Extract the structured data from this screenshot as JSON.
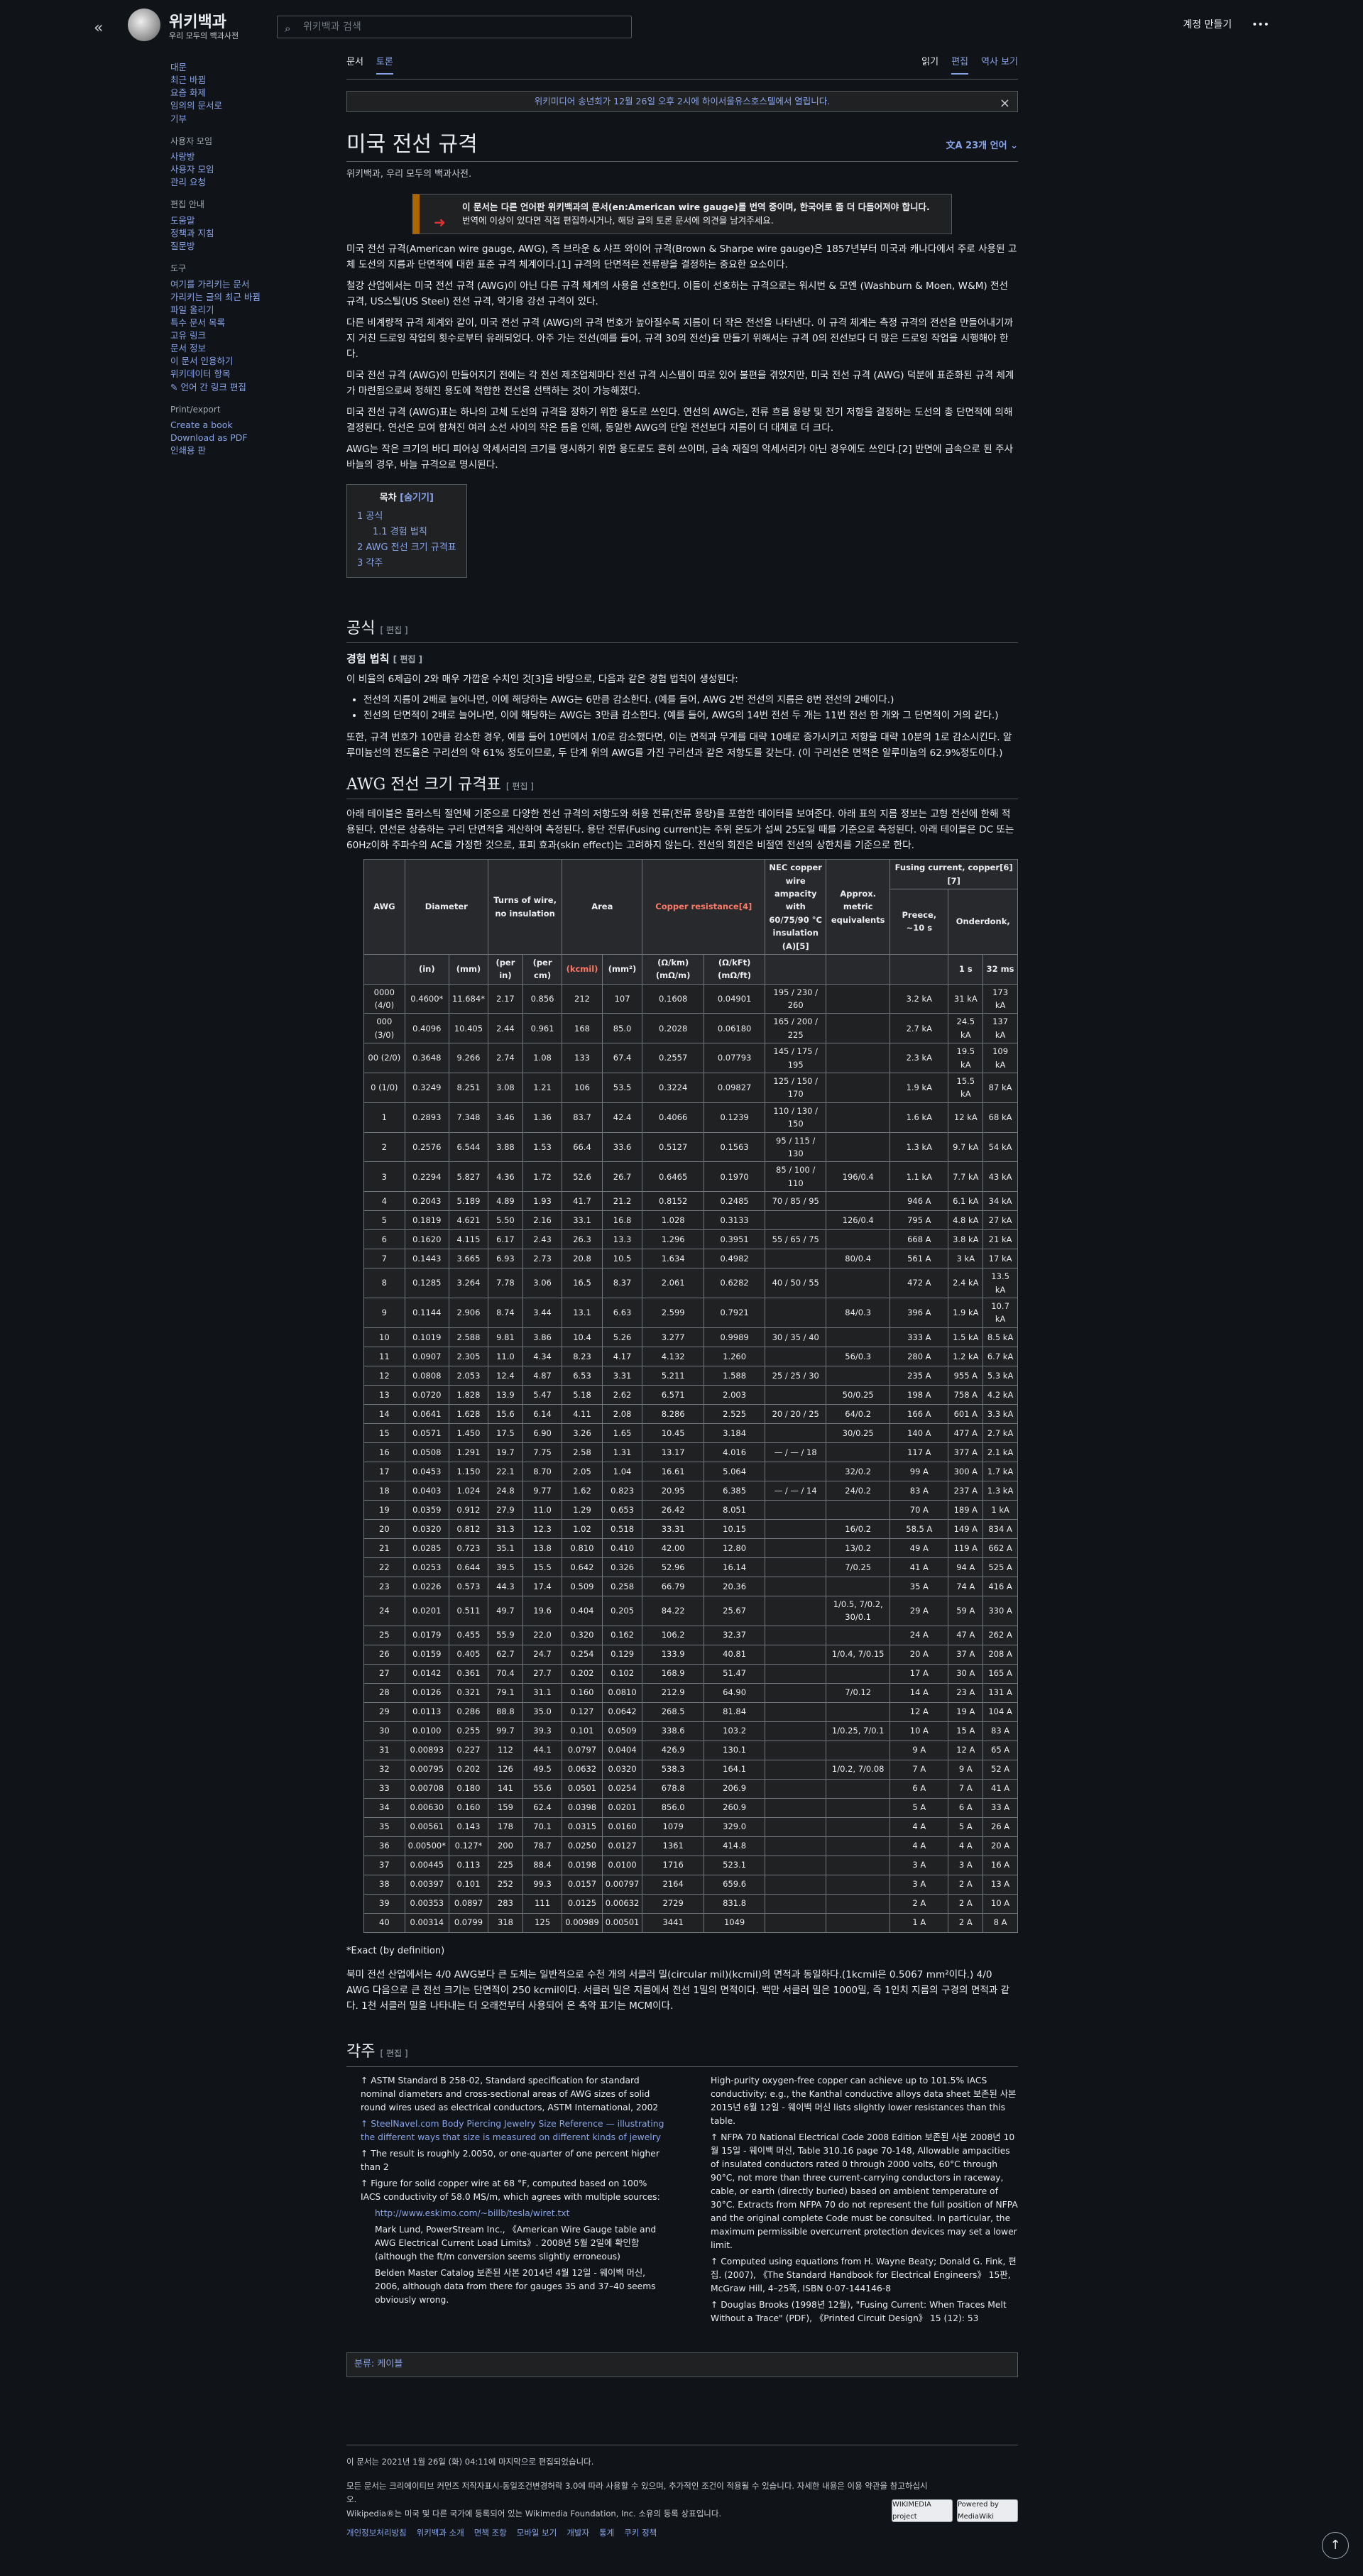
{
  "site": {
    "title": "위키백과",
    "subtitle": "우리 모두의 백과사전",
    "search_placeholder": "위키백과 검색",
    "create_account": "계정 만들기",
    "more": "•••"
  },
  "sidebar": {
    "main": [
      "대문",
      "최근 바뀜",
      "요즘 화제",
      "임의의 문서로",
      "기부"
    ],
    "users_title": "사용자 모임",
    "users": [
      "사랑방",
      "사용자 모임",
      "관리 요청"
    ],
    "guide_title": "편집 안내",
    "guide": [
      "도움말",
      "정책과 지침",
      "질문방"
    ],
    "tools_title": "도구",
    "tools": [
      "여기를 가리키는 문서",
      "가리키는 글의 최근 바뀜",
      "파일 올리기",
      "특수 문서 목록",
      "고유 링크",
      "문서 정보",
      "이 문서 인용하기",
      "위키데이터 항목",
      "언어 간 링크 편집"
    ],
    "print_title": "Print/export",
    "print": [
      "Create a book",
      "Download as PDF",
      "인쇄용 판"
    ]
  },
  "tabs": {
    "article": "문서",
    "talk": "토론",
    "read": "읽기",
    "edit": "편집",
    "history": "역사 보기"
  },
  "notice": "위키미디어 송년회가 12월 26일 오후 2시에 하이서울유스호스텔에서 열립니다.",
  "article": {
    "title": "미국 전선 규격",
    "lang_button": "23개 언어",
    "from": "위키백과, 우리 모두의 백과사전.",
    "ambox_1": "이 문서는 다른 언어판 위키백과의 문서(en:American wire gauge)를 번역 중이며, 한국어로 좀 더 다듬어져야 합니다.",
    "ambox_2": "번역에 이상이 있다면 직접 편집하시거나, 해당 글의 토론 문서에 의견을 남겨주세요.",
    "p1": "미국 전선 규격(American wire gauge, AWG), 즉 브라운 & 샤프 와이어 규격(Brown & Sharpe wire gauge)은 1857년부터 미국과 캐나다에서 주로 사용된 고체 도선의 지름과 단면적에 대한 표준 규격 체계이다.[1] 규격의 단면적은 전류량을 결정하는 중요한 요소이다.",
    "p2": "철강 산업에서는 미국 전선 규격 (AWG)이 아닌 다른 규격 체계의 사용을 선호한다. 이들이 선호하는 규격으로는 워시번 & 모엔 (Washburn & Moen, W&M) 전선 규격, US스틸(US Steel) 전선 규격, 악기용 강선 규격이 있다.",
    "p3": "다른 비계량적 규격 체계와 같이, 미국 전선 규격 (AWG)의 규격 번호가 높아질수록 지름이 더 작은 전선을 나타낸다. 이 규격 체계는 측정 규격의 전선을 만들어내기까지 거친 드로잉 작업의 횟수로부터 유래되었다. 아주 가는 전선(예를 들어, 규격 30의 전선)을 만들기 위해서는 규격 0의 전선보다 더 많은 드로잉 작업을 시행해야 한다.",
    "p4": "미국 전선 규격 (AWG)이 만들어지기 전에는 각 전선 제조업체마다 전선 규격 시스템이 따로 있어 불편을 겪었지만, 미국 전선 규격 (AWG) 덕분에 표준화된 규격 체계가 마련됨으로써 정해진 용도에 적합한 전선을 선택하는 것이 가능해졌다.",
    "p5": "미국 전선 규격 (AWG)표는 하나의 고체 도선의 규격을 정하기 위한 용도로 쓰인다. 연선의 AWG는, 전류 흐름 용량 및 전기 저항을 결정하는 도선의 총 단면적에 의해 결정된다. 연선은 모여 합쳐진 여러 소선 사이의 작은 틈을 인해, 동일한 AWG의 단일 전선보다 지름이 더 대체로 더 크다.",
    "p6": "AWG는 작은 크기의 바디 피어싱 악세서리의 크기를 명시하기 위한 용도로도 흔히 쓰이며, 금속 재질의 악세서리가 아닌 경우에도 쓰인다.[2] 반면에 금속으로 된 주사 바늘의 경우, 바늘 규격으로 명시된다."
  },
  "toc": {
    "title": "목차",
    "toggle": "[숨기기]",
    "items": [
      "1 공식",
      "1.1 경험 법칙",
      "2 AWG 전선 크기 규격표",
      "3 각주"
    ]
  },
  "sections": {
    "formula": "공식",
    "edit": "[ 편집 ]",
    "rule": "경험 법칙",
    "rule_intro": "이 비율의 6제곱이 2와 매우 가깝운 수치인 것[3]을 바탕으로, 다음과 같은 경험 법칙이 생성된다:",
    "rule_1": "전선의 지름이 2배로 늘어나면, 이에 해당하는 AWG는 6만큼 감소한다. (예를 들어, AWG 2번 전선의 지름은 8번 전선의 2배이다.)",
    "rule_2": "전선의 단면적이 2배로 늘어나면, 이에 해당하는 AWG는 3만큼 감소한다. (예를 들어, AWG의 14번 전선 두 개는 11번 전선 한 개와 그 단면적이 거의 같다.)",
    "rule_after": "또한, 규격 번호가 10만큼 감소한 경우, 예를 들어 10번에서 1/0로 감소했다면, 이는 면적과 무게를 대략 10배로 증가시키고 저항을 대략 10분의 1로 감소시킨다. 알루미늄선의 전도율은 구리선의 약 61% 정도이므로, 두 단계 위의 AWG를 가진 구리선과 같은 저항도를 갖는다. (이 구리선은 면적은 알루미늄의 62.9%정도이다.)",
    "table_title": "AWG 전선 크기 규격표",
    "table_intro": "아래 테이블은 플라스틱 절연체 기준으로 다양한 전선 규격의 저항도와 허용 전류(전류 용량)를 포함한 데이터를 보여준다. 아래 표의 지름 정보는 고형 전선에 한해 적용된다. 연선은 상층하는 구리 단면적을 계산하여 측정된다. 용단 전류(Fusing current)는 주위 온도가 섭씨 25도일 때를 기준으로 측정된다. 아래 테이블은 DC 또는 60Hz이하 주파수의 AC를 가정한 것으로, 표피 효과(skin effect)는 고려하지 않는다. 전선의 회전은 비절연 전선의 상한치를 기준으로 한다.",
    "exact": "*Exact (by definition)",
    "after_table": "북미 전선 산업에서는 4/0 AWG보다 큰 도체는 일반적으로 수천 개의 서클러 밀(circular mil)(kcmil)의 면적과 동일하다.(1kcmil은 0.5067 mm²이다.) 4/0 AWG 다음으로 큰 전선 크기는 단면적이 250 kcmil이다. 서클러 밀은 지름에서 전선 1밀의 면적이다. 백만 서클러 밀은 1000밀, 즉 1인치 지름의 구경의 면적과 같다. 1천 서클러 밀을 나타내는 더 오래전부터 사용되어 온 축약 표기는 MCM이다.",
    "notes": "각주"
  },
  "table": {
    "h_awg": "AWG",
    "h_diam": "Diameter",
    "h_turns": "Turns of wire, no insulation",
    "h_area": "Area",
    "h_res": "Copper resistance[4]",
    "h_nec": "NEC copper wire ampacity with 60/75/90 °C insulation (A)[5]",
    "h_metric": "Approx. metric equivalents",
    "h_fuse": "Fusing current, copper[6][7]",
    "h_in": "(in)",
    "h_mm": "(mm)",
    "h_perin": "(per in)",
    "h_percm": "(per cm)",
    "h_kcmil": "(kcmil)",
    "h_mm2": "(mm²)",
    "h_okm": "(Ω/km) (mΩ/m)",
    "h_okft": "(Ω/kFt) (mΩ/ft)",
    "h_preece": "Preece, ~10 s",
    "h_onder": "Onderdonk,",
    "h_1s": "1 s",
    "h_32ms": "32 ms",
    "rows": [
      [
        "0000 (4/0)",
        "0.4600*",
        "11.684*",
        "2.17",
        "0.856",
        "212",
        "107",
        "0.1608",
        "0.04901",
        "195 / 230 / 260",
        "",
        "3.2 kA",
        "31 kA",
        "173 kA"
      ],
      [
        "000 (3/0)",
        "0.4096",
        "10.405",
        "2.44",
        "0.961",
        "168",
        "85.0",
        "0.2028",
        "0.06180",
        "165 / 200 / 225",
        "",
        "2.7 kA",
        "24.5 kA",
        "137 kA"
      ],
      [
        "00 (2/0)",
        "0.3648",
        "9.266",
        "2.74",
        "1.08",
        "133",
        "67.4",
        "0.2557",
        "0.07793",
        "145 / 175 / 195",
        "",
        "2.3 kA",
        "19.5 kA",
        "109 kA"
      ],
      [
        "0 (1/0)",
        "0.3249",
        "8.251",
        "3.08",
        "1.21",
        "106",
        "53.5",
        "0.3224",
        "0.09827",
        "125 / 150 / 170",
        "",
        "1.9 kA",
        "15.5 kA",
        "87 kA"
      ],
      [
        "1",
        "0.2893",
        "7.348",
        "3.46",
        "1.36",
        "83.7",
        "42.4",
        "0.4066",
        "0.1239",
        "110 / 130 / 150",
        "",
        "1.6 kA",
        "12 kA",
        "68 kA"
      ],
      [
        "2",
        "0.2576",
        "6.544",
        "3.88",
        "1.53",
        "66.4",
        "33.6",
        "0.5127",
        "0.1563",
        "95 / 115 / 130",
        "",
        "1.3 kA",
        "9.7 kA",
        "54 kA"
      ],
      [
        "3",
        "0.2294",
        "5.827",
        "4.36",
        "1.72",
        "52.6",
        "26.7",
        "0.6465",
        "0.1970",
        "85 / 100 / 110",
        "196/0.4",
        "1.1 kA",
        "7.7 kA",
        "43 kA"
      ],
      [
        "4",
        "0.2043",
        "5.189",
        "4.89",
        "1.93",
        "41.7",
        "21.2",
        "0.8152",
        "0.2485",
        "70 / 85 / 95",
        "",
        "946 A",
        "6.1 kA",
        "34 kA"
      ],
      [
        "5",
        "0.1819",
        "4.621",
        "5.50",
        "2.16",
        "33.1",
        "16.8",
        "1.028",
        "0.3133",
        "",
        "126/0.4",
        "795 A",
        "4.8 kA",
        "27 kA"
      ],
      [
        "6",
        "0.1620",
        "4.115",
        "6.17",
        "2.43",
        "26.3",
        "13.3",
        "1.296",
        "0.3951",
        "55 / 65 / 75",
        "",
        "668 A",
        "3.8 kA",
        "21 kA"
      ],
      [
        "7",
        "0.1443",
        "3.665",
        "6.93",
        "2.73",
        "20.8",
        "10.5",
        "1.634",
        "0.4982",
        "",
        "80/0.4",
        "561 A",
        "3 kA",
        "17 kA"
      ],
      [
        "8",
        "0.1285",
        "3.264",
        "7.78",
        "3.06",
        "16.5",
        "8.37",
        "2.061",
        "0.6282",
        "40 / 50 / 55",
        "",
        "472 A",
        "2.4 kA",
        "13.5 kA"
      ],
      [
        "9",
        "0.1144",
        "2.906",
        "8.74",
        "3.44",
        "13.1",
        "6.63",
        "2.599",
        "0.7921",
        "",
        "84/0.3",
        "396 A",
        "1.9 kA",
        "10.7 kA"
      ],
      [
        "10",
        "0.1019",
        "2.588",
        "9.81",
        "3.86",
        "10.4",
        "5.26",
        "3.277",
        "0.9989",
        "30 / 35 / 40",
        "",
        "333 A",
        "1.5 kA",
        "8.5 kA"
      ],
      [
        "11",
        "0.0907",
        "2.305",
        "11.0",
        "4.34",
        "8.23",
        "4.17",
        "4.132",
        "1.260",
        "",
        "56/0.3",
        "280 A",
        "1.2 kA",
        "6.7 kA"
      ],
      [
        "12",
        "0.0808",
        "2.053",
        "12.4",
        "4.87",
        "6.53",
        "3.31",
        "5.211",
        "1.588",
        "25 / 25 / 30",
        "",
        "235 A",
        "955 A",
        "5.3 kA"
      ],
      [
        "13",
        "0.0720",
        "1.828",
        "13.9",
        "5.47",
        "5.18",
        "2.62",
        "6.571",
        "2.003",
        "",
        "50/0.25",
        "198 A",
        "758 A",
        "4.2 kA"
      ],
      [
        "14",
        "0.0641",
        "1.628",
        "15.6",
        "6.14",
        "4.11",
        "2.08",
        "8.286",
        "2.525",
        "20 / 20 / 25",
        "64/0.2",
        "166 A",
        "601 A",
        "3.3 kA"
      ],
      [
        "15",
        "0.0571",
        "1.450",
        "17.5",
        "6.90",
        "3.26",
        "1.65",
        "10.45",
        "3.184",
        "",
        "30/0.25",
        "140 A",
        "477 A",
        "2.7 kA"
      ],
      [
        "16",
        "0.0508",
        "1.291",
        "19.7",
        "7.75",
        "2.58",
        "1.31",
        "13.17",
        "4.016",
        "— / — / 18",
        "",
        "117 A",
        "377 A",
        "2.1 kA"
      ],
      [
        "17",
        "0.0453",
        "1.150",
        "22.1",
        "8.70",
        "2.05",
        "1.04",
        "16.61",
        "5.064",
        "",
        "32/0.2",
        "99 A",
        "300 A",
        "1.7 kA"
      ],
      [
        "18",
        "0.0403",
        "1.024",
        "24.8",
        "9.77",
        "1.62",
        "0.823",
        "20.95",
        "6.385",
        "— / — / 14",
        "24/0.2",
        "83 A",
        "237 A",
        "1.3 kA"
      ],
      [
        "19",
        "0.0359",
        "0.912",
        "27.9",
        "11.0",
        "1.29",
        "0.653",
        "26.42",
        "8.051",
        "",
        "",
        "70 A",
        "189 A",
        "1 kA"
      ],
      [
        "20",
        "0.0320",
        "0.812",
        "31.3",
        "12.3",
        "1.02",
        "0.518",
        "33.31",
        "10.15",
        "",
        "16/0.2",
        "58.5 A",
        "149 A",
        "834 A"
      ],
      [
        "21",
        "0.0285",
        "0.723",
        "35.1",
        "13.8",
        "0.810",
        "0.410",
        "42.00",
        "12.80",
        "",
        "13/0.2",
        "49 A",
        "119 A",
        "662 A"
      ],
      [
        "22",
        "0.0253",
        "0.644",
        "39.5",
        "15.5",
        "0.642",
        "0.326",
        "52.96",
        "16.14",
        "",
        "7/0.25",
        "41 A",
        "94 A",
        "525 A"
      ],
      [
        "23",
        "0.0226",
        "0.573",
        "44.3",
        "17.4",
        "0.509",
        "0.258",
        "66.79",
        "20.36",
        "",
        "",
        "35 A",
        "74 A",
        "416 A"
      ],
      [
        "24",
        "0.0201",
        "0.511",
        "49.7",
        "19.6",
        "0.404",
        "0.205",
        "84.22",
        "25.67",
        "",
        "1/0.5, 7/0.2, 30/0.1",
        "29 A",
        "59 A",
        "330 A"
      ],
      [
        "25",
        "0.0179",
        "0.455",
        "55.9",
        "22.0",
        "0.320",
        "0.162",
        "106.2",
        "32.37",
        "",
        "",
        "24 A",
        "47 A",
        "262 A"
      ],
      [
        "26",
        "0.0159",
        "0.405",
        "62.7",
        "24.7",
        "0.254",
        "0.129",
        "133.9",
        "40.81",
        "",
        "1/0.4, 7/0.15",
        "20 A",
        "37 A",
        "208 A"
      ],
      [
        "27",
        "0.0142",
        "0.361",
        "70.4",
        "27.7",
        "0.202",
        "0.102",
        "168.9",
        "51.47",
        "",
        "",
        "17 A",
        "30 A",
        "165 A"
      ],
      [
        "28",
        "0.0126",
        "0.321",
        "79.1",
        "31.1",
        "0.160",
        "0.0810",
        "212.9",
        "64.90",
        "",
        "7/0.12",
        "14 A",
        "23 A",
        "131 A"
      ],
      [
        "29",
        "0.0113",
        "0.286",
        "88.8",
        "35.0",
        "0.127",
        "0.0642",
        "268.5",
        "81.84",
        "",
        "",
        "12 A",
        "19 A",
        "104 A"
      ],
      [
        "30",
        "0.0100",
        "0.255",
        "99.7",
        "39.3",
        "0.101",
        "0.0509",
        "338.6",
        "103.2",
        "",
        "1/0.25, 7/0.1",
        "10 A",
        "15 A",
        "83 A"
      ],
      [
        "31",
        "0.00893",
        "0.227",
        "112",
        "44.1",
        "0.0797",
        "0.0404",
        "426.9",
        "130.1",
        "",
        "",
        "9 A",
        "12 A",
        "65 A"
      ],
      [
        "32",
        "0.00795",
        "0.202",
        "126",
        "49.5",
        "0.0632",
        "0.0320",
        "538.3",
        "164.1",
        "",
        "1/0.2, 7/0.08",
        "7 A",
        "9 A",
        "52 A"
      ],
      [
        "33",
        "0.00708",
        "0.180",
        "141",
        "55.6",
        "0.0501",
        "0.0254",
        "678.8",
        "206.9",
        "",
        "",
        "6 A",
        "7 A",
        "41 A"
      ],
      [
        "34",
        "0.00630",
        "0.160",
        "159",
        "62.4",
        "0.0398",
        "0.0201",
        "856.0",
        "260.9",
        "",
        "",
        "5 A",
        "6 A",
        "33 A"
      ],
      [
        "35",
        "0.00561",
        "0.143",
        "178",
        "70.1",
        "0.0315",
        "0.0160",
        "1079",
        "329.0",
        "",
        "",
        "4 A",
        "5 A",
        "26 A"
      ],
      [
        "36",
        "0.00500*",
        "0.127*",
        "200",
        "78.7",
        "0.0250",
        "0.0127",
        "1361",
        "414.8",
        "",
        "",
        "4 A",
        "4 A",
        "20 A"
      ],
      [
        "37",
        "0.00445",
        "0.113",
        "225",
        "88.4",
        "0.0198",
        "0.0100",
        "1716",
        "523.1",
        "",
        "",
        "3 A",
        "3 A",
        "16 A"
      ],
      [
        "38",
        "0.00397",
        "0.101",
        "252",
        "99.3",
        "0.0157",
        "0.00797",
        "2164",
        "659.6",
        "",
        "",
        "3 A",
        "2 A",
        "13 A"
      ],
      [
        "39",
        "0.00353",
        "0.0897",
        "283",
        "111",
        "0.0125",
        "0.00632",
        "2729",
        "831.8",
        "",
        "",
        "2 A",
        "2 A",
        "10 A"
      ],
      [
        "40",
        "0.00314",
        "0.0799",
        "318",
        "125",
        "0.00989",
        "0.00501",
        "3441",
        "1049",
        "",
        "",
        "1 A",
        "2 A",
        "8 A"
      ]
    ]
  },
  "refs_left": [
    "↑ ASTM Standard B 258-02, Standard specification for standard nominal diameters and cross-sectional areas of AWG sizes of solid round wires used as electrical conductors, ASTM International, 2002",
    "↑ SteelNavel.com Body Piercing Jewelry Size Reference — illustrating the different ways that size is measured on different kinds of jewelry",
    "↑ The result is roughly 2.0050, or one-quarter of one percent higher than 2",
    "↑ Figure for solid copper wire at 68 °F, computed based on 100% IACS conductivity of 58.0 MS/m, which agrees with multiple sources:",
    "http://www.eskimo.com/~billb/tesla/wiret.txt",
    "Mark Lund, PowerStream Inc., 《American Wire Gauge table and AWG Electrical Current Load Limits》. 2008년 5월 2일에 확인함 (although the ft/m conversion seems slightly erroneous)",
    "Belden Master Catalog 보존된 사본 2014년 4월 12일 - 웨이백 머신, 2006, although data from there for gauges 35 and 37–40 seems obviously wrong."
  ],
  "refs_right": [
    "High-purity oxygen-free copper can achieve up to 101.5% IACS conductivity; e.g., the Kanthal conductive alloys data sheet 보존된 사본 2015년 6월 12일 - 웨이백 머신 lists slightly lower resistances than this table.",
    "↑ NFPA 70 National Electrical Code 2008 Edition 보존된 사본 2008년 10월 15일 - 웨이백 머신, Table 310.16 page 70-148, Allowable ampacities of insulated conductors rated 0 through 2000 volts, 60°C through 90°C, not more than three current-carrying conductors in raceway, cable, or earth (directly buried) based on ambient temperature of 30°C. Extracts from NFPA 70 do not represent the full position of NFPA and the original complete Code must be consulted. In particular, the maximum permissible overcurrent protection devices may set a lower limit.",
    "↑ Computed using equations from H. Wayne Beaty; Donald G. Fink, 편집. (2007), 《The Standard Handbook for Electrical Engineers》 15판, McGraw Hill, 4–25쪽, ISBN 0-07-144146-8",
    "↑ Douglas Brooks (1998년 12월), \"Fusing Current: When Traces Melt Without a Trace\" (PDF), 《Printed Circuit Design》 15 (12): 53"
  ],
  "category": "분류: 케이블",
  "footer": {
    "modified": "이 문서는 2021년 1월 26일 (화) 04:11에 마지막으로 편집되었습니다.",
    "license": "모든 문서는 크리에이티브 커먼즈 저작자표시-동일조건변경허락 3.0에 따라 사용할 수 있으며, 추가적인 조건이 적용될 수 있습니다. 자세한 내용은 이용 약관을 참고하십시오.",
    "trademark": "Wikipedia®는 미국 및 다른 국가에 등록되어 있는 Wikimedia Foundation, Inc. 소유의 등록 상표입니다.",
    "links": [
      "개인정보처리방침",
      "위키백과 소개",
      "면책 조항",
      "모바일 보기",
      "개발자",
      "통계",
      "쿠키 정책"
    ],
    "badge1": "WIKIMEDIA project",
    "badge2": "Powered by MediaWiki"
  }
}
